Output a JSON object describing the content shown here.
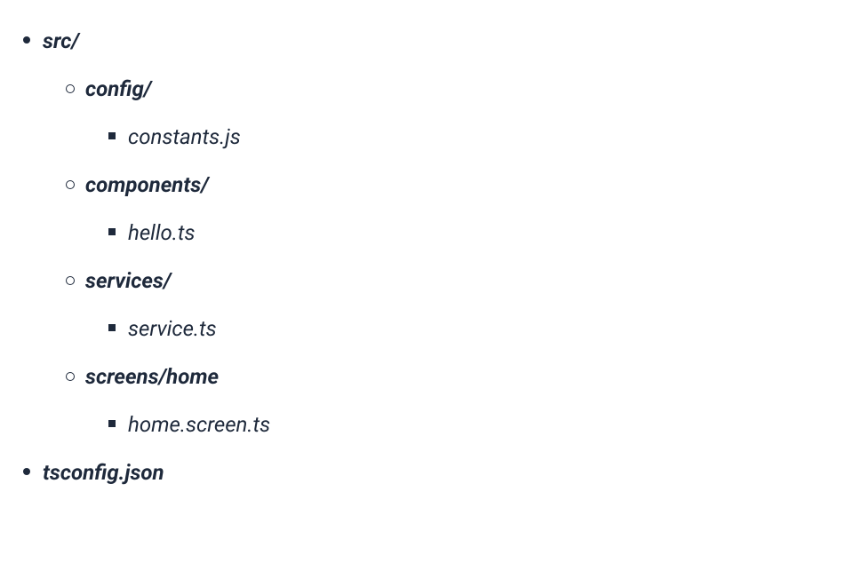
{
  "tree": {
    "root": [
      {
        "label": "src/",
        "type": "folder",
        "children": [
          {
            "label": "config/",
            "type": "folder",
            "children": [
              {
                "label": "constants.js",
                "type": "file"
              }
            ]
          },
          {
            "label": "components/",
            "type": "folder",
            "children": [
              {
                "label": "hello.ts",
                "type": "file"
              }
            ]
          },
          {
            "label": "services/",
            "type": "folder",
            "children": [
              {
                "label": "service.ts",
                "type": "file"
              }
            ]
          },
          {
            "label": "screens/home",
            "type": "folder",
            "children": [
              {
                "label": "home.screen.ts",
                "type": "file"
              }
            ]
          }
        ]
      },
      {
        "label": "tsconfig.json",
        "type": "folder"
      }
    ]
  }
}
